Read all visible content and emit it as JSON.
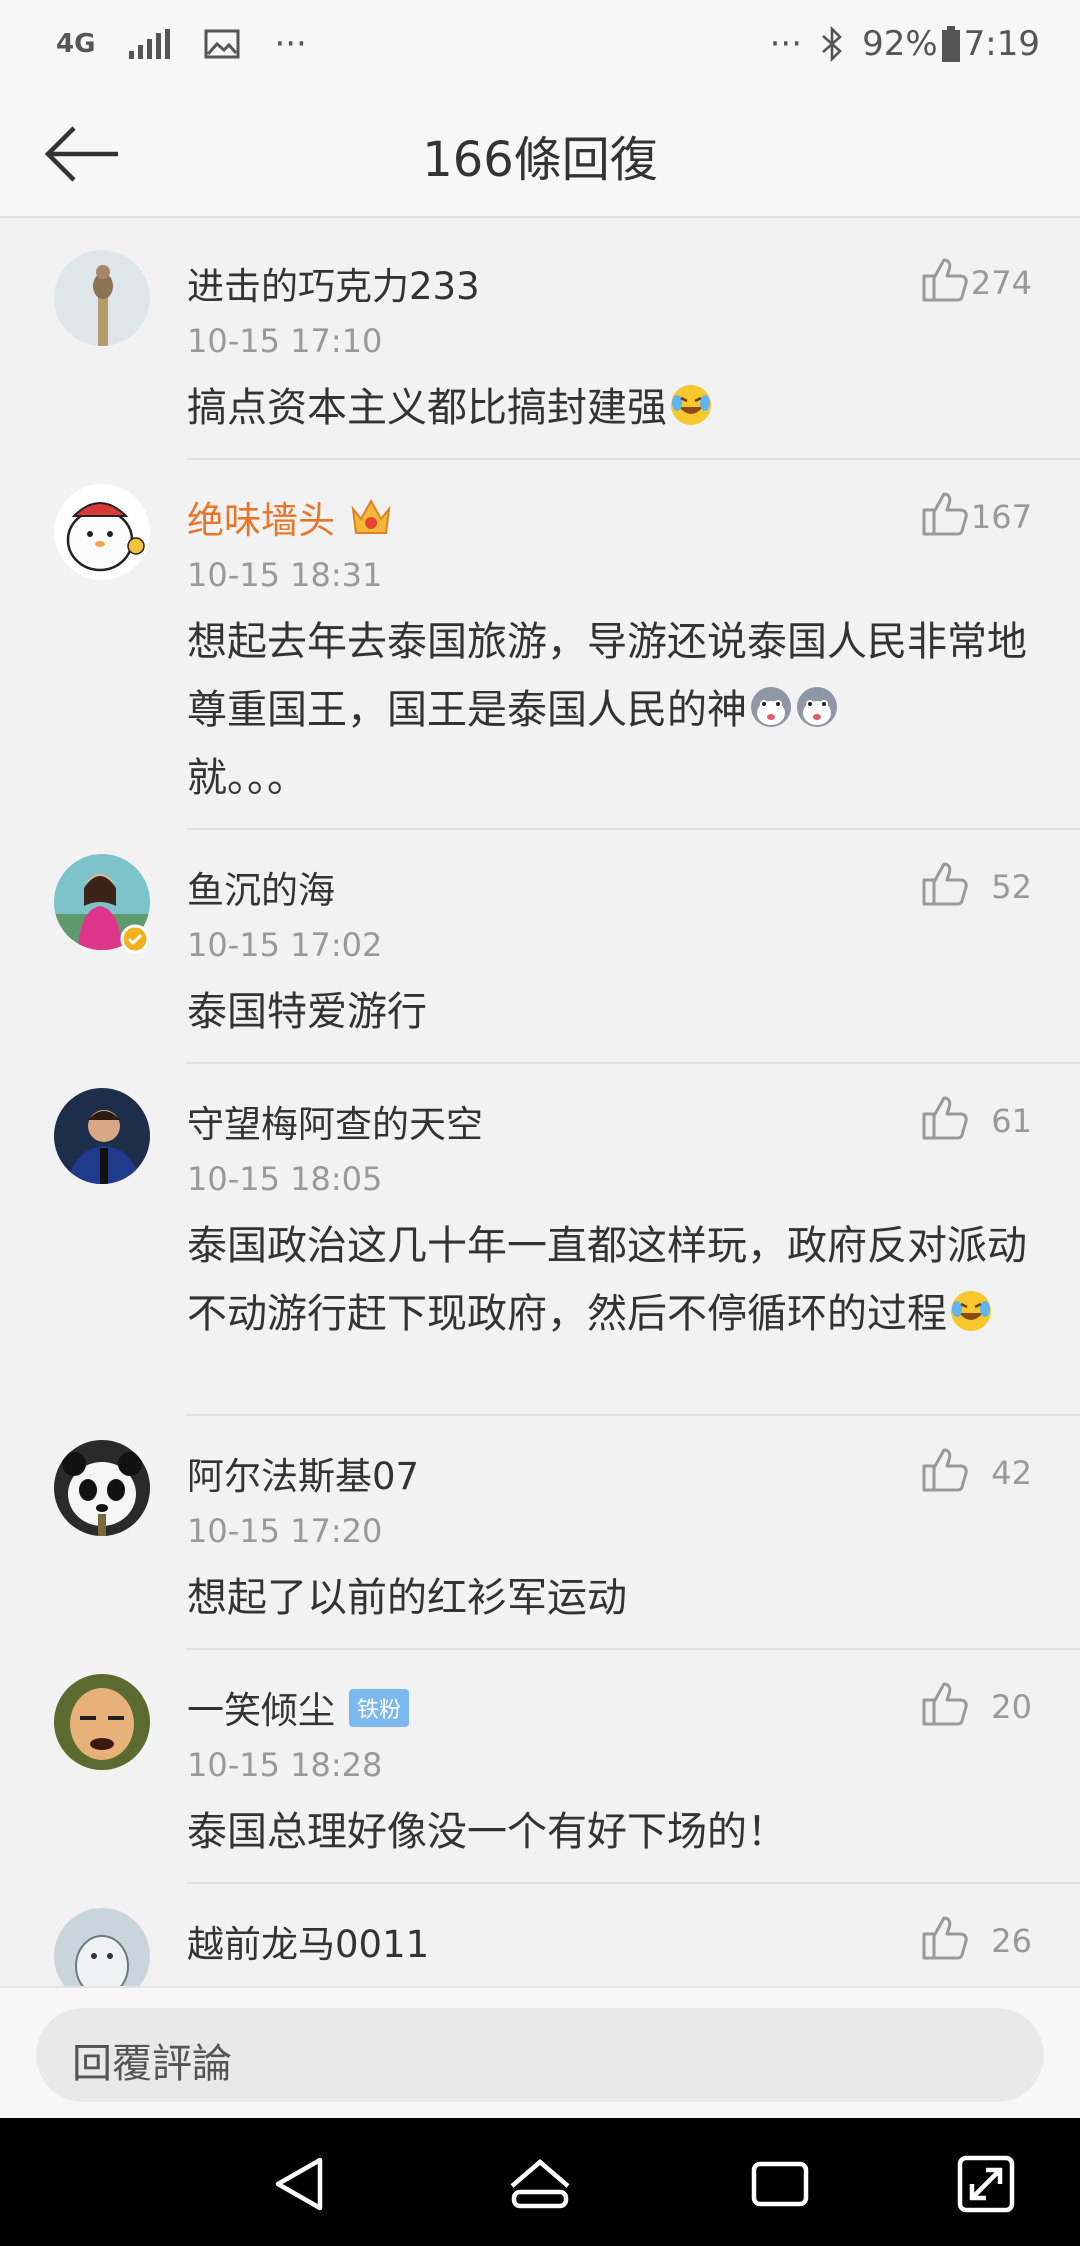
{
  "status_bar": {
    "network": "4G",
    "more_left": "···",
    "more_right": "···",
    "battery": "92%",
    "time": "7:19"
  },
  "header": {
    "title": "166條回復"
  },
  "comments": [
    {
      "user": "进击的巧克力233",
      "time": "10-15 17:10",
      "text": "搞点资本主义都比搞封建强",
      "likes": "274"
    },
    {
      "user": "绝味墙头",
      "time": "10-15 18:31",
      "text": "想起去年去泰国旅游，导游还说泰国人民非常地尊重国王，国王是泰国人民的神",
      "text_tail": "就。。。",
      "likes": "167"
    },
    {
      "user": "鱼沉的海",
      "time": "10-15 17:02",
      "text": "泰国特爱游行",
      "likes": "52"
    },
    {
      "user": "守望梅阿查的天空",
      "time": "10-15 18:05",
      "text": "泰国政治这几十年一直都这样玩，政府反对派动不动游行赶下现政府，然后不停循环的过程",
      "likes": "61"
    },
    {
      "user": "阿尔法斯基07",
      "time": "10-15 17:20",
      "text": "想起了以前的红衫军运动",
      "likes": "42"
    },
    {
      "user": "一笑倾尘",
      "badge": "铁粉",
      "time": "10-15 18:28",
      "text": "泰国总理好像没一个有好下场的！",
      "likes": "20"
    },
    {
      "user": "越前龙马0011",
      "likes": "26"
    }
  ],
  "reply_bar": {
    "placeholder": "回覆評論"
  },
  "colors": {
    "accent_orange": "#e8762a",
    "fan_badge": "#7ab8ef",
    "nav_bg": "#000000"
  }
}
